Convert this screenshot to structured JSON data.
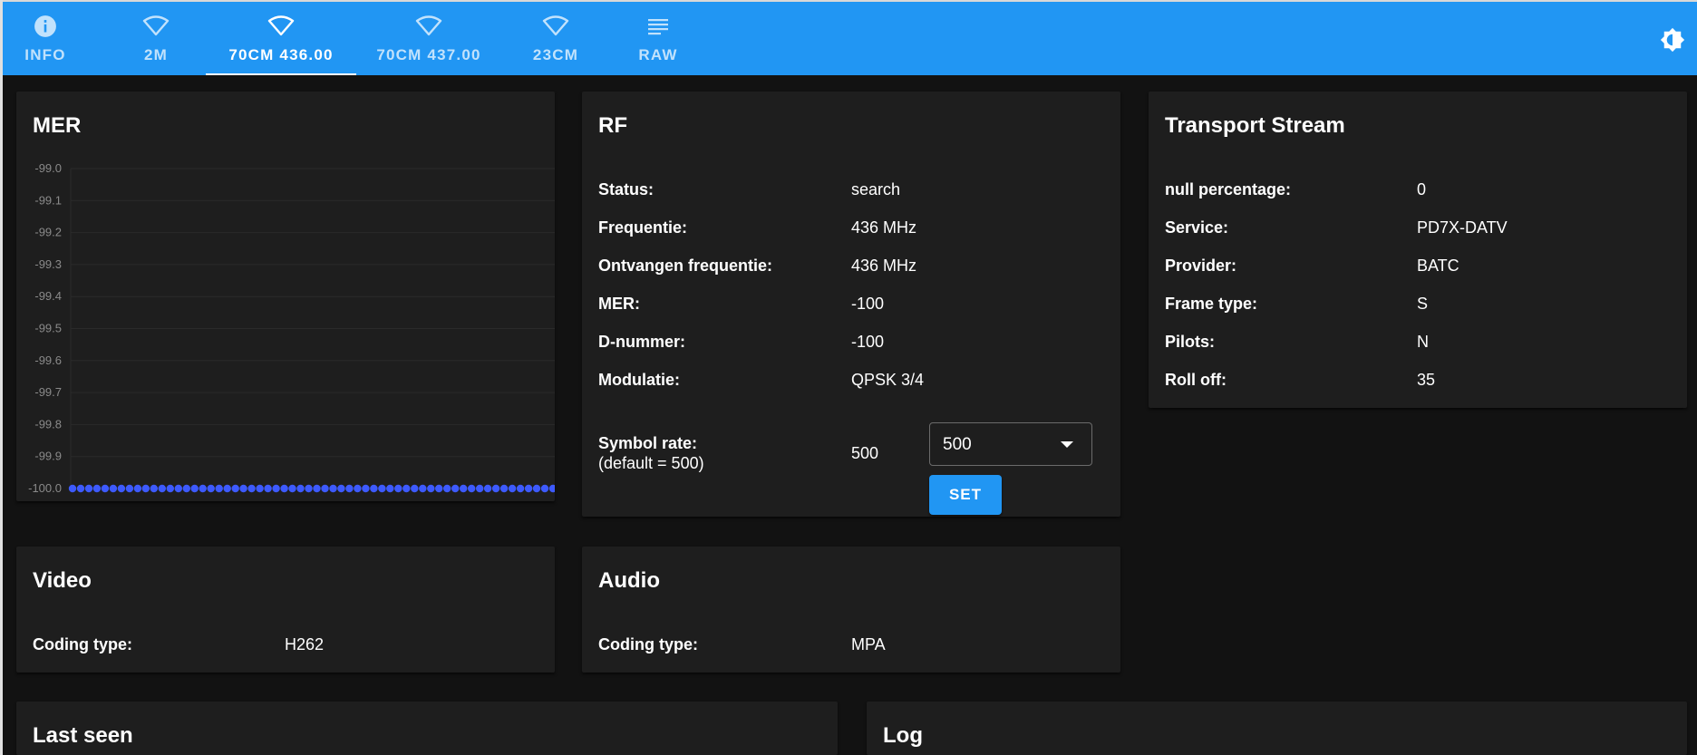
{
  "tabs": [
    {
      "label": "INFO",
      "icon": "info-icon"
    },
    {
      "label": "2M",
      "icon": "wifi-icon"
    },
    {
      "label": "70CM 436.00",
      "icon": "wifi-icon",
      "active": true
    },
    {
      "label": "70CM 437.00",
      "icon": "wifi-icon"
    },
    {
      "label": "23CM",
      "icon": "wifi-icon"
    },
    {
      "label": "RAW",
      "icon": "list-icon"
    }
  ],
  "theme_toggle_icon": "brightness-icon",
  "mer_card": {
    "title": "MER",
    "chart_data": {
      "type": "scatter",
      "title": "",
      "xlabel": "",
      "ylabel": "",
      "ylim": [
        -100.0,
        -99.0
      ],
      "y_ticks": [
        "-99.0",
        "-99.1",
        "-99.2",
        "-99.3",
        "-99.4",
        "-99.5",
        "-99.6",
        "-99.7",
        "-99.8",
        "-99.9",
        "-100.0"
      ],
      "point_count": 60,
      "series": [
        {
          "color": "#3d5afe",
          "value": -100.0
        }
      ],
      "grid": true
    }
  },
  "rf_card": {
    "title": "RF",
    "rows": [
      {
        "label": "Status:",
        "value": "search"
      },
      {
        "label": "Frequentie:",
        "value": "436 MHz"
      },
      {
        "label": "Ontvangen frequentie:",
        "value": "436 MHz"
      },
      {
        "label": "MER:",
        "value": "-100"
      },
      {
        "label": "D-nummer:",
        "value": "-100"
      },
      {
        "label": "Modulatie:",
        "value": "QPSK 3/4"
      }
    ],
    "symbol_rate": {
      "label": "Symbol rate:",
      "sublabel": "(default = 500)",
      "value": "500",
      "selected": "500",
      "set_label": "SET"
    }
  },
  "ts_card": {
    "title": "Transport Stream",
    "rows": [
      {
        "label": "null percentage:",
        "value": "0"
      },
      {
        "label": "Service:",
        "value": "PD7X-DATV"
      },
      {
        "label": "Provider:",
        "value": "BATC"
      },
      {
        "label": "Frame type:",
        "value": "S"
      },
      {
        "label": "Pilots:",
        "value": "N"
      },
      {
        "label": "Roll off:",
        "value": "35"
      }
    ]
  },
  "video_card": {
    "title": "Video",
    "rows": [
      {
        "label": "Coding type:",
        "value": "H262"
      }
    ]
  },
  "audio_card": {
    "title": "Audio",
    "rows": [
      {
        "label": "Coding type:",
        "value": "MPA"
      }
    ]
  },
  "last_seen_card": {
    "title": "Last seen"
  },
  "log_card": {
    "title": "Log"
  },
  "colors": {
    "accent": "#2196f3",
    "background": "#121212",
    "card": "#1e1e1e",
    "mer_points": "#3d5afe"
  }
}
